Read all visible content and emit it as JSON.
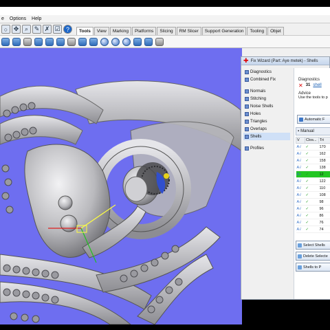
{
  "menu": [
    "e",
    "Options",
    "Help"
  ],
  "toolbar_tabs": [
    "Tools",
    "View",
    "Marking",
    "Platforms",
    "Slicing",
    "RM Slicer",
    "Support Generation",
    "Tooling",
    "Objet"
  ],
  "fix_wizard": {
    "title": "Fix Wizard (Part: Aye metek) - Shells",
    "nav": [
      "Diagnostics",
      "Combined Fix",
      "Normals",
      "Stitching",
      "Noise Shells",
      "Holes",
      "Triangles",
      "Overlaps",
      "Shells",
      "Profiles"
    ],
    "diagnostics_label": "Diagnostics",
    "diagnostics_count": "31",
    "diagnostics_link": "shell",
    "advice_label": "Advice",
    "advice_text": "Use the tools to p",
    "automatic_button": "Automatic F",
    "manual_label": "Manual",
    "table_headers": [
      "V",
      "Clos...",
      "Tri"
    ],
    "rows": [
      {
        "v": "A√",
        "closed": "✓",
        "tri": "170"
      },
      {
        "v": "A√",
        "closed": "✓",
        "tri": "162"
      },
      {
        "v": "A√",
        "closed": "✓",
        "tri": "158"
      },
      {
        "v": "A√",
        "closed": "✓",
        "tri": "138"
      },
      {
        "v": "A√",
        "closed": "✓",
        "tri": "12"
      },
      {
        "v": "A√",
        "closed": "✓",
        "tri": "122"
      },
      {
        "v": "A√",
        "closed": "✓",
        "tri": "110"
      },
      {
        "v": "A√",
        "closed": "✓",
        "tri": "108"
      },
      {
        "v": "A√",
        "closed": "✓",
        "tri": "98"
      },
      {
        "v": "A√",
        "closed": "✓",
        "tri": "96"
      },
      {
        "v": "A√",
        "closed": "✓",
        "tri": "86"
      },
      {
        "v": "A√",
        "closed": "✓",
        "tri": "76"
      },
      {
        "v": "A√",
        "closed": "✓",
        "tri": "74"
      }
    ],
    "select_shells_button": "Select Shells",
    "delete_button": "Delete Selecte",
    "shells_to_button": "Shells to P"
  },
  "colors": {
    "viewport_bg": "#6e6ef0",
    "model": "#c9c9cc",
    "highlight_row": "#23c623"
  }
}
